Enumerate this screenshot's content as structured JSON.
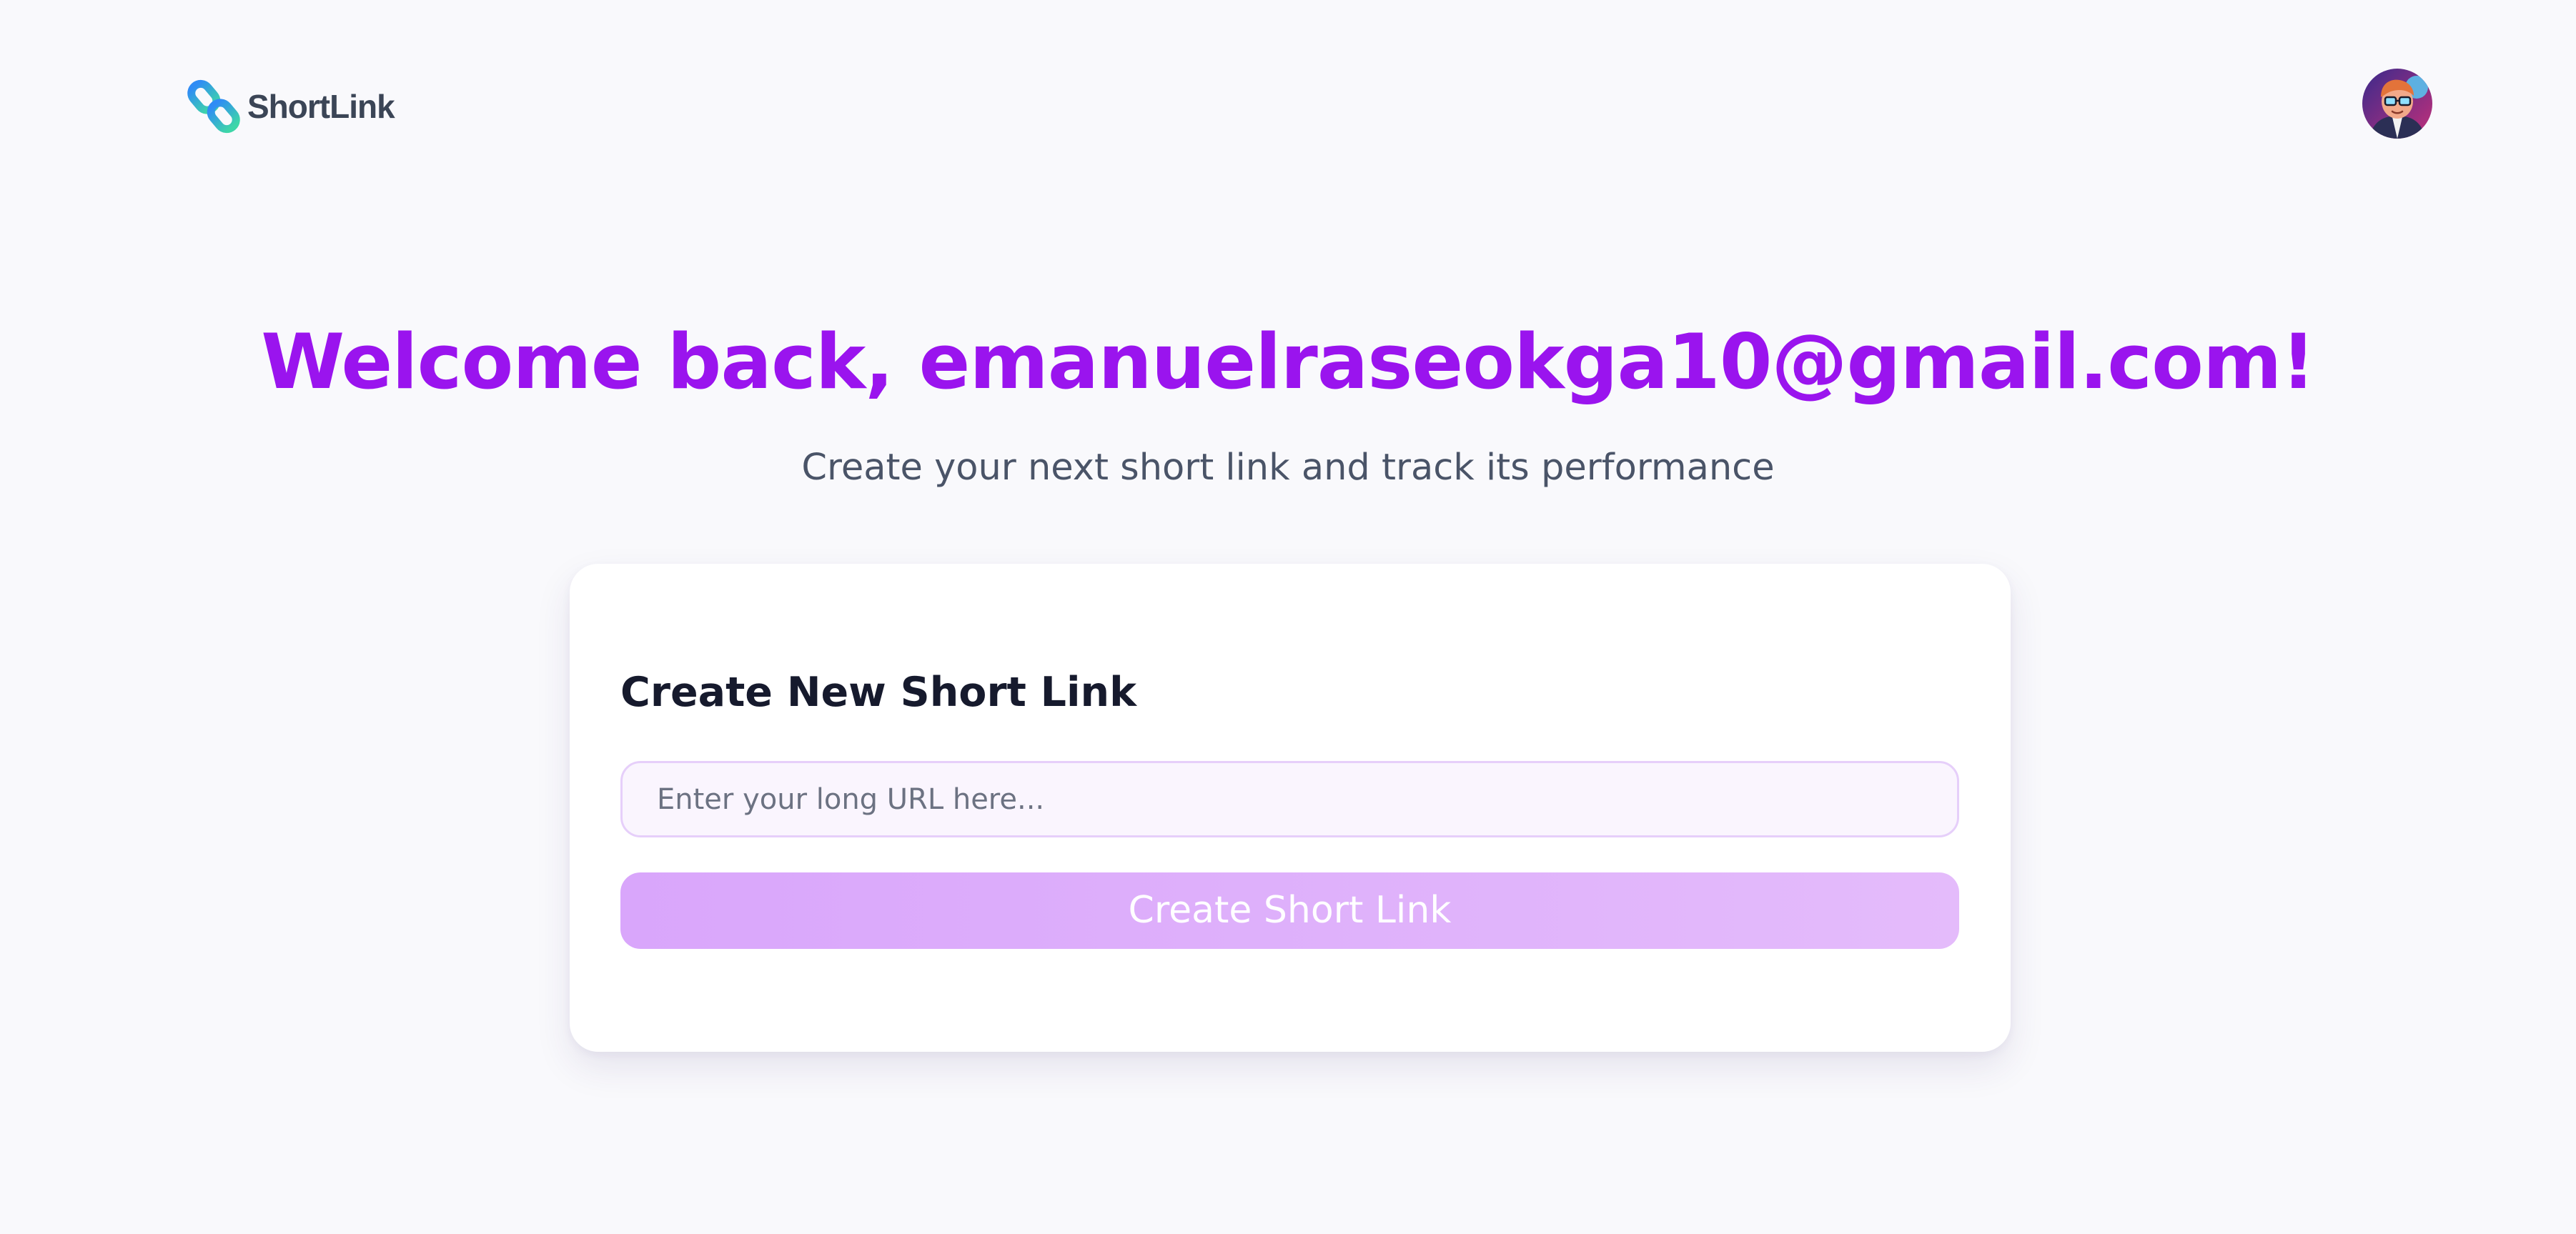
{
  "header": {
    "logo_text": "ShortLink",
    "logo_icon": "chain-link-icon",
    "avatar_icon": "user-avatar"
  },
  "hero": {
    "welcome": "Welcome back, emanuelraseokga10@gmail.com!",
    "subtitle": "Create your next short link and track its performance"
  },
  "card": {
    "title": "Create New Short Link",
    "url_input": {
      "value": "",
      "placeholder": "Enter your long URL here..."
    },
    "create_button_label": "Create Short Link"
  },
  "colors": {
    "background": "#f9f9fc",
    "accent": "#9a14ee",
    "button_gradient_start": "#d9a6fb",
    "button_gradient_end": "#e4bbfb",
    "input_border": "#e6cffa",
    "logo_gradient_start": "#2f8cf5",
    "logo_gradient_end": "#3ed6a8"
  }
}
